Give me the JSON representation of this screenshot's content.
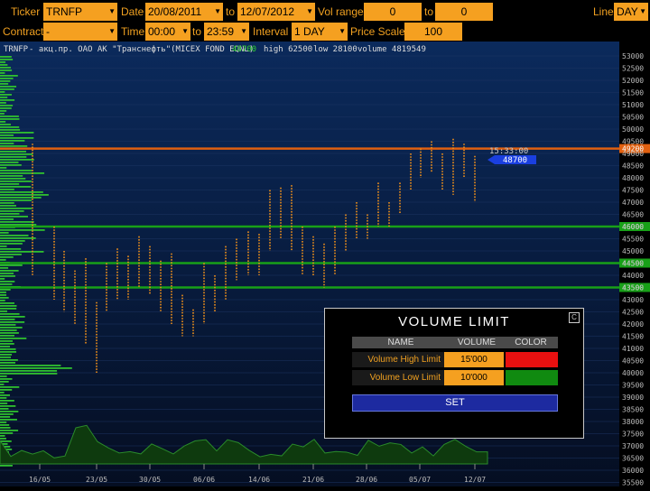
{
  "toolbar1": {
    "ticker_label": "Ticker",
    "ticker_value": "TRNFP",
    "date_label": "Date",
    "date_from": "20/08/2011",
    "to_label": "to",
    "date_to": "12/07/2012",
    "vol_range_label": "Vol range",
    "vol_from": "0",
    "vol_to_label": "to",
    "vol_to": "0",
    "line_label": "Line",
    "line_value": "DAY"
  },
  "toolbar2": {
    "contract_label": "Contract",
    "contract_value": "-",
    "time_label": "Time",
    "time_from": "00:00",
    "to_label": "to",
    "time_to": "23:59",
    "interval_label": "Interval",
    "interval_value": "1 DAY",
    "price_scale_label": "Price Scale",
    "price_scale_value": "100"
  },
  "info_bar": {
    "symbol": "TRNFP",
    "description": " - акц.пр. ОАО АК \"Транснефть\"(MICEX FOND EQNL)",
    "last": "48700",
    "high_text": "high 62500",
    "low_text": "low 28100",
    "volume_text": "volume 4819549"
  },
  "chart": {
    "y_ticks": [
      "53000",
      "52500",
      "52000",
      "51500",
      "51000",
      "50500",
      "50000",
      "49500",
      "49000",
      "48500",
      "48000",
      "47500",
      "47000",
      "46500",
      "46000",
      "45500",
      "45000",
      "44500",
      "44000",
      "43500",
      "43000",
      "42500",
      "42000",
      "41500",
      "41000",
      "40500",
      "40000",
      "39500",
      "39000",
      "38500",
      "38000",
      "37500",
      "37000",
      "36500",
      "36000",
      "35500"
    ],
    "x_ticks": [
      "16/05",
      "23/05",
      "30/05",
      "06/06",
      "14/06",
      "21/06",
      "28/06",
      "05/07",
      "12/07"
    ],
    "time_stamp": "15:33:00",
    "last_price": "48700",
    "levels": [
      {
        "price": "49200",
        "color": "#e06010"
      },
      {
        "price": "46000",
        "color": "#18a018"
      },
      {
        "price": "44500",
        "color": "#18a018"
      },
      {
        "price": "43500",
        "color": "#18a018"
      }
    ]
  },
  "dialog": {
    "title": "VOLUME LIMIT",
    "close": "C",
    "headers": [
      "NAME",
      "VOLUME",
      "COLOR"
    ],
    "rows": [
      {
        "name": "Volume High Limit",
        "volume": "15'000",
        "color": "#e81010"
      },
      {
        "name": "Volume Low Limit",
        "volume": "10'000",
        "color": "#108a10"
      }
    ],
    "set_label": "SET"
  }
}
